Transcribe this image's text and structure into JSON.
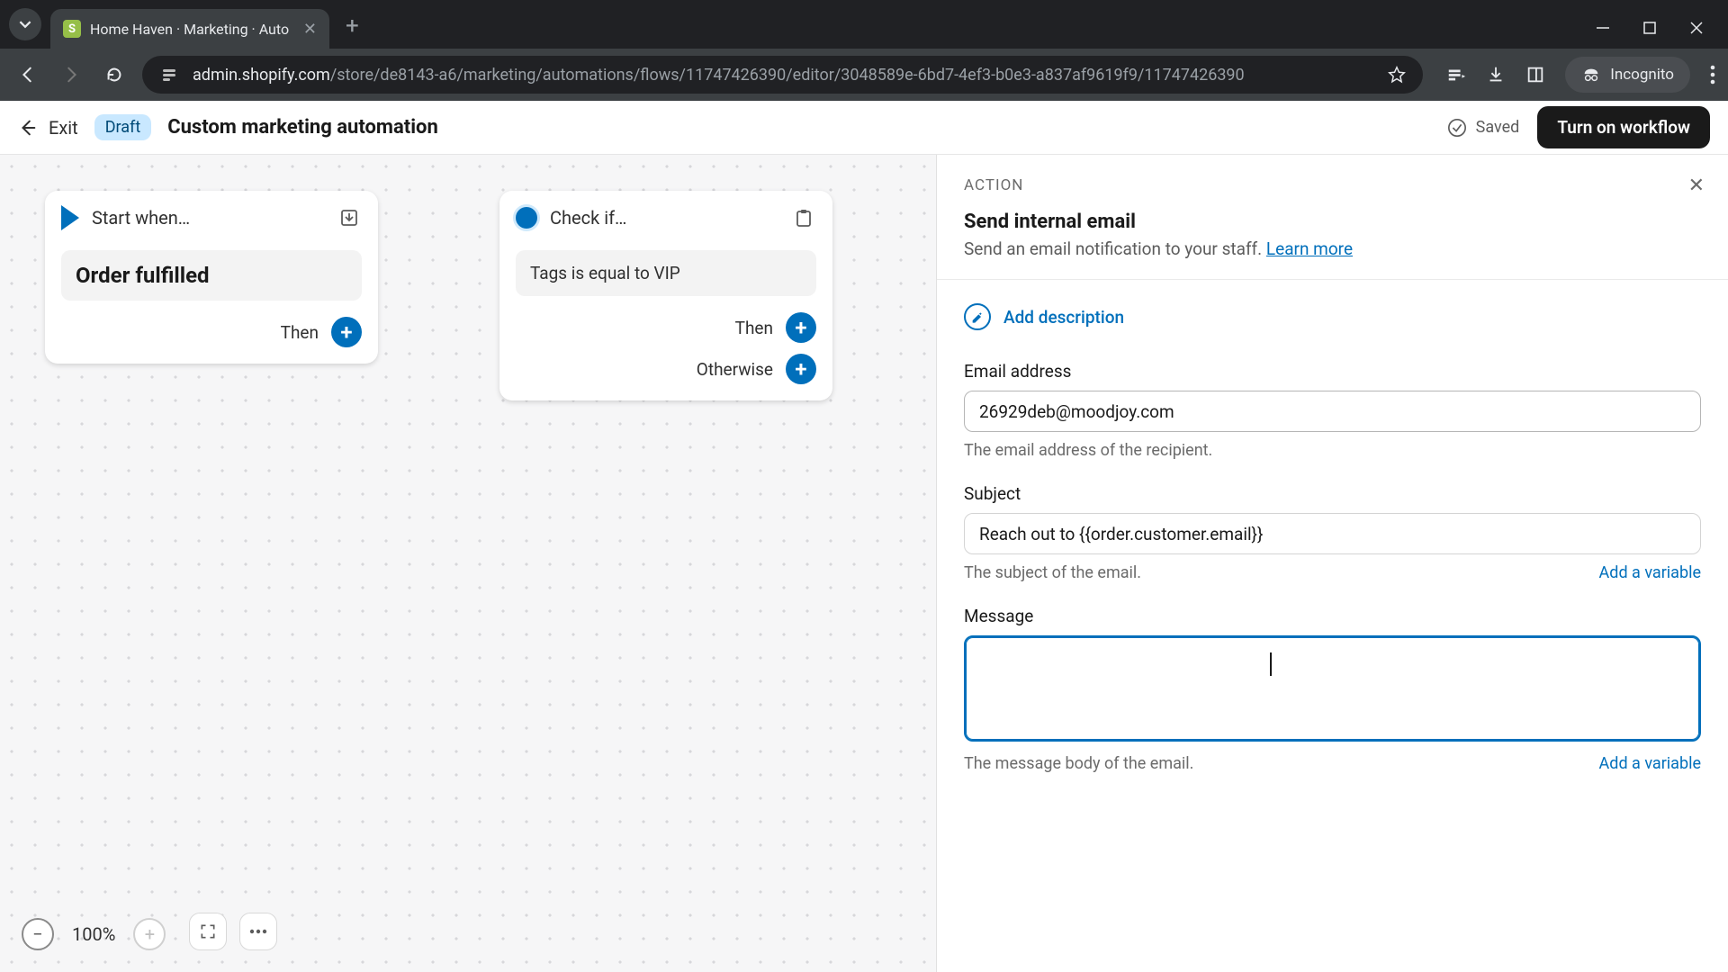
{
  "browser": {
    "tab_title": "Home Haven · Marketing · Auto",
    "url_host": "admin.shopify.com",
    "url_path": "/store/de8143-a6/marketing/automations/flows/11747426390/editor/3048589e-6bd7-4ef3-b0e3-a837af9619f9/11747426390",
    "incognito_label": "Incognito"
  },
  "header": {
    "exit": "Exit",
    "draft_badge": "Draft",
    "title": "Custom marketing automation",
    "saved": "Saved",
    "turn_on": "Turn on workflow"
  },
  "canvas": {
    "start_label": "Start when…",
    "start_body": "Order fulfilled",
    "check_label": "Check if…",
    "check_body": "Tags is equal to VIP",
    "then": "Then",
    "otherwise": "Otherwise",
    "zoom": "100%"
  },
  "panel": {
    "kicker": "ACTION",
    "title": "Send internal email",
    "subtitle_pre": "Send an email notification to your staff. ",
    "learn_more": "Learn more",
    "add_description": "Add description",
    "email_label": "Email address",
    "email_value": "26929deb@moodjoy.com",
    "email_help": "The email address of the recipient.",
    "subject_label": "Subject",
    "subject_value": "Reach out to {{order.customer.email}}",
    "subject_help": "The subject of the email.",
    "add_variable": "Add a variable",
    "message_label": "Message",
    "message_value": "",
    "message_help": "The message body of the email."
  }
}
